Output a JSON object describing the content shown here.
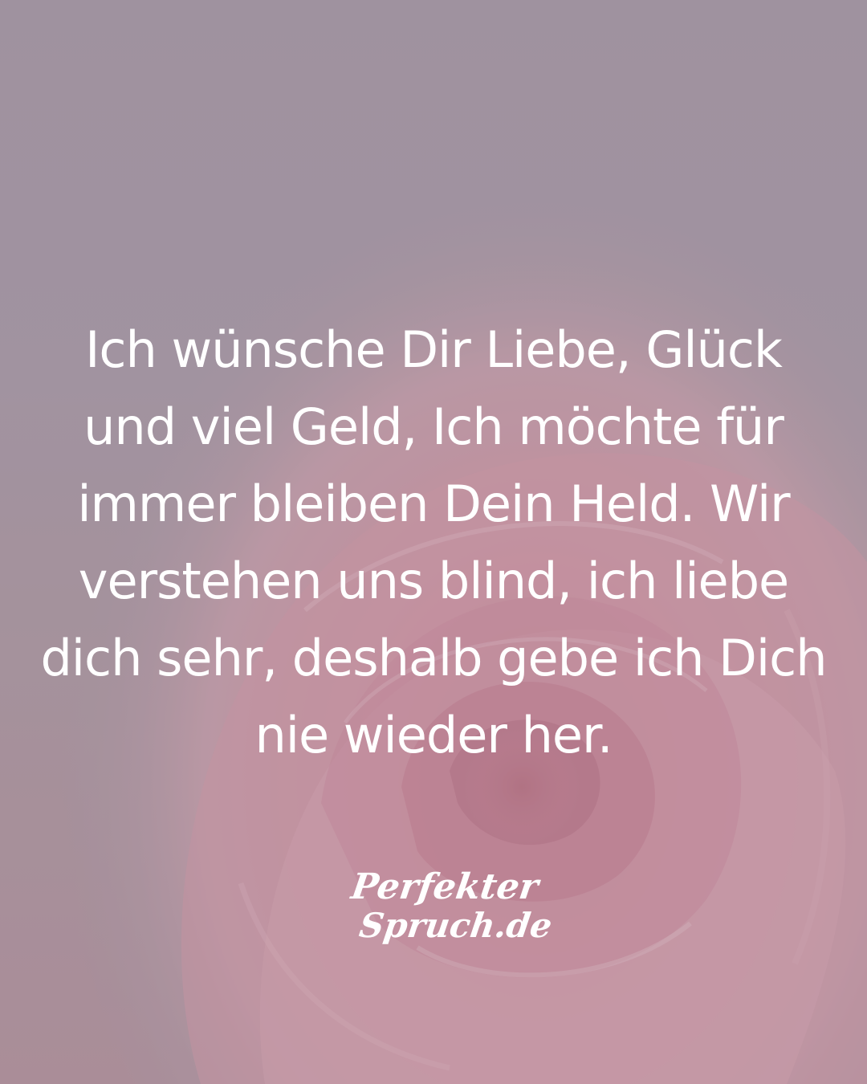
{
  "quote": {
    "text": "Ich wünsche Dir Liebe, Glück und viel Geld, Ich möchte für immer bleiben Dein Held. Wir verstehen uns blind, ich liebe dich sehr, deshalb gebe ich Dich nie wieder her."
  },
  "logo": {
    "line1": "Perfekter",
    "line2": "Spruch.de"
  },
  "colors": {
    "background": "#a0909f",
    "rose": "#d98a9c",
    "text": "#ffffff"
  }
}
